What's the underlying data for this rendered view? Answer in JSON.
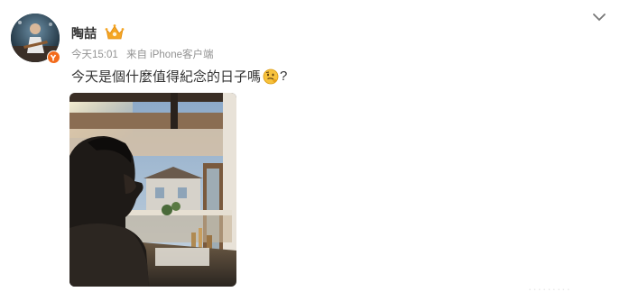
{
  "post": {
    "username": "陶喆",
    "timestamp": "今天15:01",
    "source": "来自 iPhone客户端",
    "text": "今天是個什麼值得紀念的日子嗎",
    "text_suffix": "?"
  },
  "watermark": "·········",
  "icons": {
    "menu": "chevron-down-icon",
    "vip": "crown-icon",
    "verified": "verified-badge-icon",
    "emoji": "thinking-face-emoji-icon"
  },
  "colors": {
    "verified_badge": "#f36b1c",
    "vip_crown": "#f5a623",
    "meta_text": "#939393",
    "username": "#333333"
  }
}
